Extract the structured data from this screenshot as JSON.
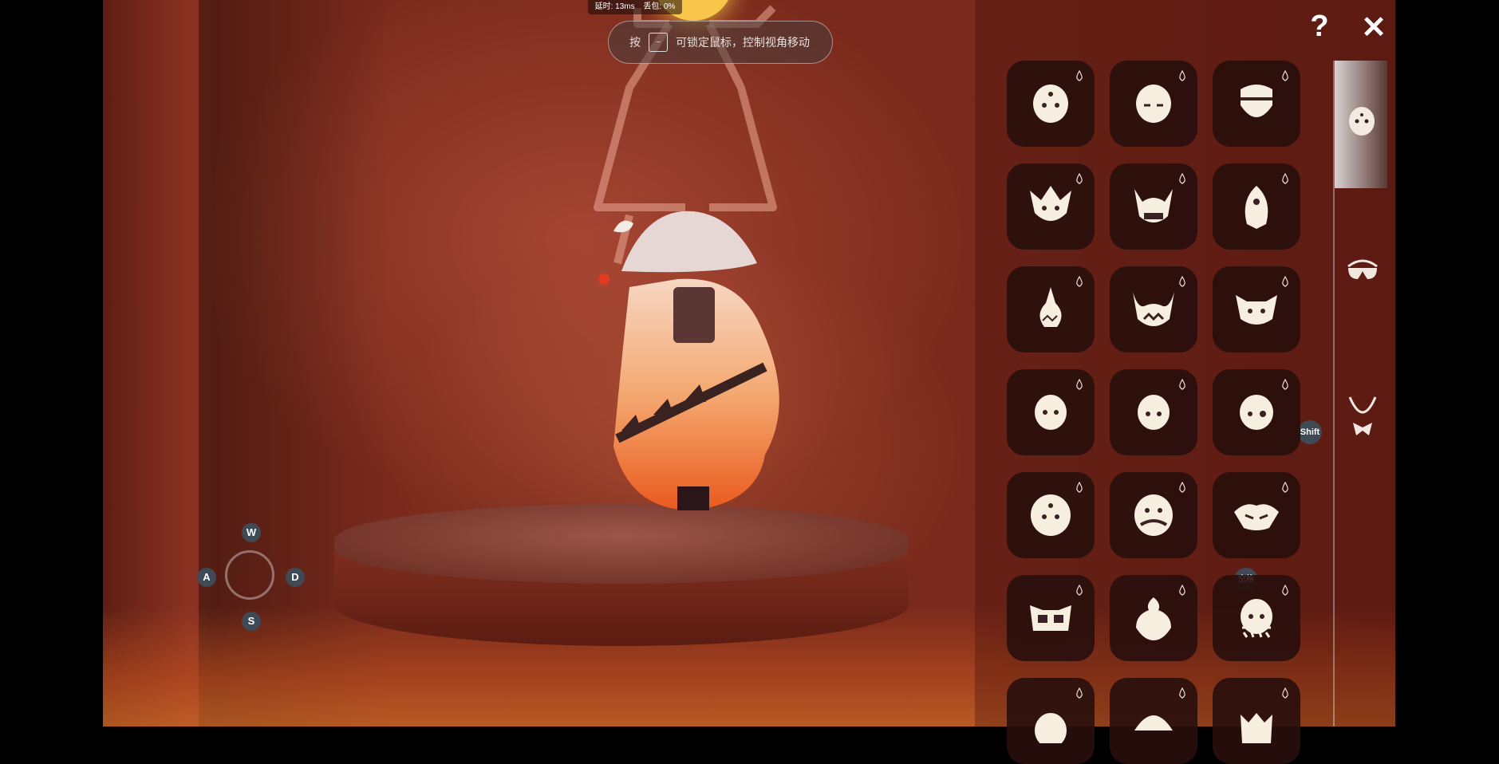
{
  "hud": {
    "latency_label": "延时: 13ms",
    "packet_loss_label": "丢包: 0%",
    "hint_prefix": "按",
    "hint_key": "~",
    "hint_text": "可锁定鼠标，控制视角移动"
  },
  "controls": {
    "up": "W",
    "left": "A",
    "right": "D",
    "down": "S"
  },
  "panel": {
    "help_icon": "?",
    "close_icon": "✕",
    "shift_badge": "Shift",
    "space_badge": "空格",
    "tabs": [
      {
        "name": "mask-tab",
        "active": true
      },
      {
        "name": "glasses-tab",
        "active": false
      },
      {
        "name": "necklace-tab",
        "active": false
      }
    ],
    "items": [
      "mask-plain-dots",
      "mask-sleepy",
      "mask-headband",
      "mask-spiky-crown",
      "mask-horned-skull",
      "mask-teardrop-tribal",
      "mask-tall-fang",
      "mask-bull-horns",
      "mask-winged",
      "mask-round-small",
      "mask-round-small-2",
      "mask-round-patch",
      "mask-round-big",
      "mask-mustache",
      "mask-bat",
      "mask-goggles",
      "mask-bird-helmet",
      "mask-fringe",
      "mask-partial-1",
      "mask-partial-2",
      "mask-partial-3"
    ]
  }
}
